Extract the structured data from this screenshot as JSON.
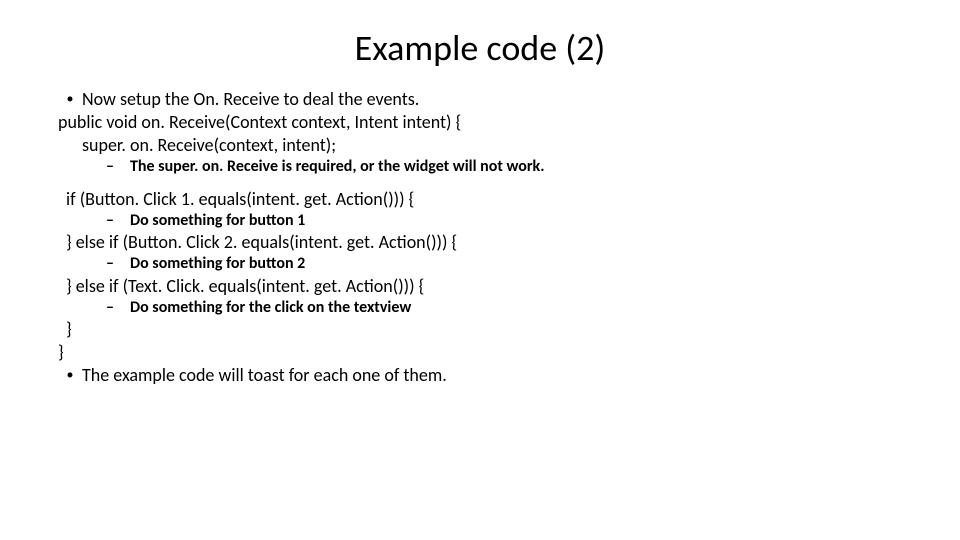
{
  "title": "Example code (2)",
  "b1": "Now setup the On. Receive to deal the events.",
  "l1": "public void on. Receive(Context context, Intent intent) {",
  "l2": "super. on. Receive(context, intent);",
  "s1": "The super. on. Receive is required, or the widget will not work.",
  "l3": "if (Button. Click 1. equals(intent. get. Action())) {",
  "s2": "Do something for button 1",
  "l4": "} else if (Button. Click 2. equals(intent. get. Action())) {",
  "s3": "Do something for button 2",
  "l5": "} else if (Text. Click. equals(intent. get. Action())) {",
  "s4": "Do something for the click on the textview",
  "l6": "}",
  "l7": "}",
  "b2": "The example code will toast for each one of them."
}
